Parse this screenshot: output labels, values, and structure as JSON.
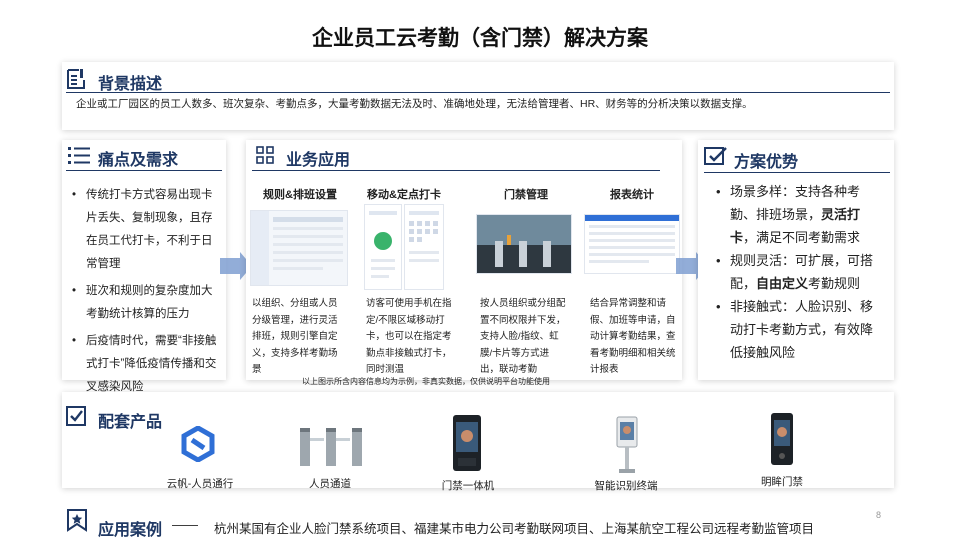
{
  "title": "企业员工云考勤（含门禁）解决方案",
  "background": {
    "heading": "背景描述",
    "text": "企业或工厂园区的员工人数多、班次复杂、考勤点多，大量考勤数据无法及时、准确地处理，无法给管理者、HR、财务等的分析决策以数据支撑。"
  },
  "pain": {
    "heading": "痛点及需求",
    "items": [
      "传统打卡方式容易出现卡片丢失、复制现象，且存在员工代打卡，不利于日常管理",
      "班次和规则的复杂度加大考勤统计核算的压力",
      "后疫情时代，需要“非接触式打卡”降低疫情传播和交叉感染风险"
    ]
  },
  "business": {
    "heading": "业务应用",
    "columns": [
      {
        "title": "规则&排班设置",
        "desc": "以组织、分组或人员分级管理，进行灵活排班，规则引擎自定义，支持多样考勤场景"
      },
      {
        "title": "移动&定点打卡",
        "desc": "访客可使用手机在指定/不限区域移动打卡，也可以在指定考勤点非接触式打卡，同时测温"
      },
      {
        "title": "门禁管理",
        "desc": "按人员组织或分组配置不同权限并下发，支持人脸/指纹、虹膜/卡片等方式进出，联动考勤"
      },
      {
        "title": "报表统计",
        "desc": "结合异常调整和请假、加班等申请，自动计算考勤结果，查看考勤明细和相关统计报表"
      }
    ],
    "footnote": "以上图示所含内容信息均为示例，非真实数据，仅供说明平台功能使用"
  },
  "advantage": {
    "heading": "方案优势",
    "items": [
      {
        "pre": "场景多样：支持各种考勤、排班场景，",
        "bold": "灵活打卡",
        "post": "，满足不同考勤需求"
      },
      {
        "pre": "规则灵活：可扩展，可搭配，",
        "bold": "自由定义",
        "post": "考勤规则"
      },
      {
        "pre": "非接触式：人脸识别、移动打卡考勤方式，有效降低接触风险",
        "bold": "",
        "post": ""
      }
    ]
  },
  "products": {
    "heading": "配套产品",
    "items": [
      {
        "label": "云帆-人员通行",
        "icon": "cloud-sail-logo-icon"
      },
      {
        "label": "人员通道",
        "icon": "turnstile-gate-icon"
      },
      {
        "label": "门禁一体机",
        "icon": "access-control-terminal-icon"
      },
      {
        "label": "智能识别终端",
        "icon": "smart-recognition-terminal-icon"
      },
      {
        "label": "明眸门禁",
        "icon": "face-access-panel-icon"
      }
    ]
  },
  "cases": {
    "heading": "应用案例",
    "dash": "——",
    "text": "杭州某国有企业人脸门禁系统项目、福建某市电力公司考勤联网项目、上海某航空工程公司远程考勤监管项目"
  },
  "page_number": "8",
  "colors": {
    "heading": "#1f3864",
    "accent": "#2f6fd6",
    "arrow": "#7f9fd1"
  }
}
